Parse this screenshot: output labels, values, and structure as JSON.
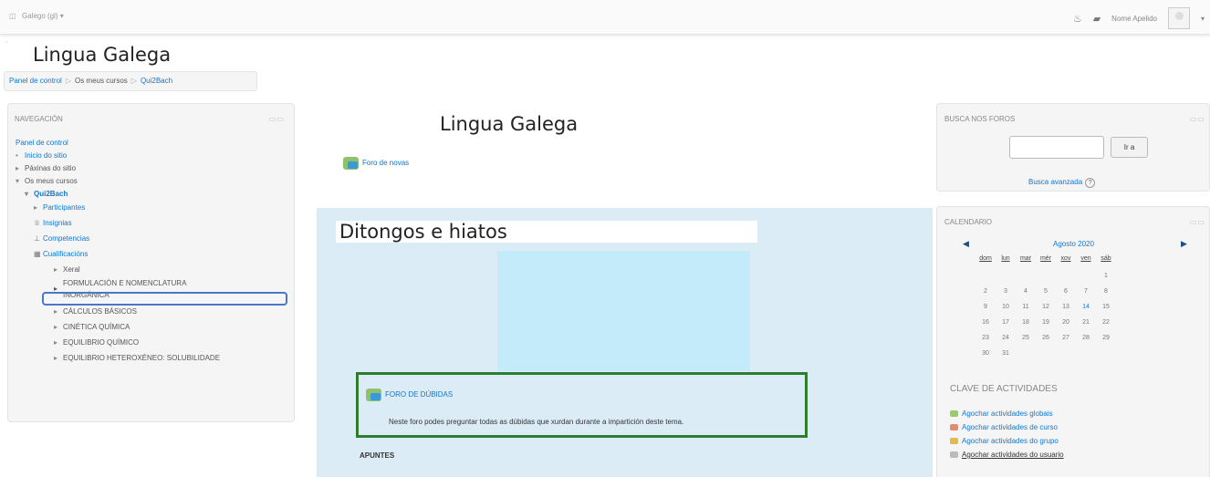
{
  "topbar": {
    "language": "Galego (gl) ▾",
    "user": "Nome Apelido"
  },
  "page_title": "Lingua Galega",
  "breadcrumb": [
    "Panel de control",
    "Os meus cursos",
    "Qui2Bach"
  ],
  "nav": {
    "header": "NAVEGACIÓN",
    "items": [
      {
        "label": "Panel de control"
      },
      {
        "label": "Inicio do sitio"
      },
      {
        "label": "Páxinas do sitio"
      },
      {
        "label": "Os meus cursos"
      },
      {
        "label": "Qui2Bach"
      },
      {
        "label": "Participantes"
      },
      {
        "label": "Insignias"
      },
      {
        "label": "Competencias"
      },
      {
        "label": "Cualificacións"
      },
      {
        "label": "Xeral"
      },
      {
        "label": "FORMULACIÓN E NOMENCLATURA"
      },
      {
        "label": "INORGÁNICA"
      },
      {
        "label": "CÁLCULOS BÁSICOS"
      },
      {
        "label": "CINÉTICA QUÍMICA"
      },
      {
        "label": "EQUILIBRIO QUÍMICO"
      },
      {
        "label": "EQUILIBRIO HETEROXÉNEO: SOLUBILIDADE"
      }
    ]
  },
  "main": {
    "title": "Lingua Galega",
    "news_forum": "Foro de novas",
    "section_title": "Ditongos e hiatos",
    "doubts_forum": "FORO DE DÚBIDAS",
    "doubts_desc": "Neste foro podes preguntar todas as dúbidas que xurdan durante a impartición deste tema.",
    "apuntes": "APUNTES"
  },
  "search": {
    "header": "BUSCA NOS FOROS",
    "button": "Ir a",
    "advanced": "Busca avanzada",
    "value": ""
  },
  "calendar": {
    "header": "CALENDARIO",
    "month": "Agosto 2020",
    "weekdays": [
      "dom",
      "lun",
      "mar",
      "mér",
      "xov",
      "ven",
      "sáb"
    ],
    "days": [
      "1",
      "2",
      "3",
      "4",
      "5",
      "6",
      "7",
      "8",
      "9",
      "10",
      "11",
      "12",
      "13",
      "14",
      "15",
      "16",
      "17",
      "18",
      "19",
      "20",
      "21",
      "22",
      "23",
      "24",
      "25",
      "26",
      "27",
      "28",
      "29",
      "30",
      "31"
    ],
    "today": "14",
    "key_title": "CLAVE DE ACTIVIDADES",
    "key_items": [
      "Agochar actividades globais",
      "Agochar actividades de curso",
      "Agochar actividades do grupo",
      "Agochar actividades do usuario"
    ],
    "key_colors": [
      "#9bc96b",
      "#e08e6b",
      "#e0b94f",
      "#bbbbbb"
    ]
  }
}
